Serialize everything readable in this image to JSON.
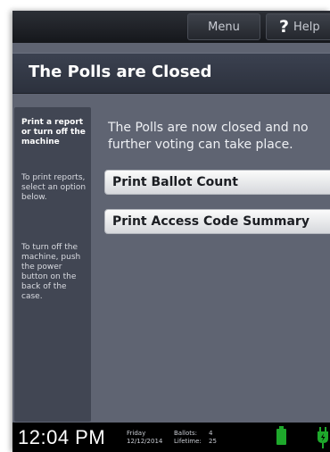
{
  "topbar": {
    "menu_label": "Menu",
    "help_icon": "?",
    "help_label": "Help"
  },
  "title": "The Polls are Closed",
  "sidebar": {
    "heading": "Print a report or turn off the machine",
    "text1": "To print reports, select an option below.",
    "text2": "To turn off the machine, push the power button on the back of the case."
  },
  "main": {
    "message": "The Polls are now closed and no further voting can take place.",
    "buttons": {
      "ballot_count": "Print Ballot Count",
      "access_code_summary": "Print Access Code Summary"
    }
  },
  "statusbar": {
    "time": "12:04 PM",
    "day": "Friday",
    "date": "12/12/2014",
    "ballots_label": "Ballots:",
    "ballots_value": "4",
    "lifetime_label": "Lifetime:",
    "lifetime_value": "25",
    "battery_icon": "battery-icon",
    "power_icon": "power-plug-icon"
  },
  "colors": {
    "background": "#5f6472",
    "titlebar": "#353a47",
    "sidebar": "#414653",
    "battery": "#1ea82b"
  }
}
